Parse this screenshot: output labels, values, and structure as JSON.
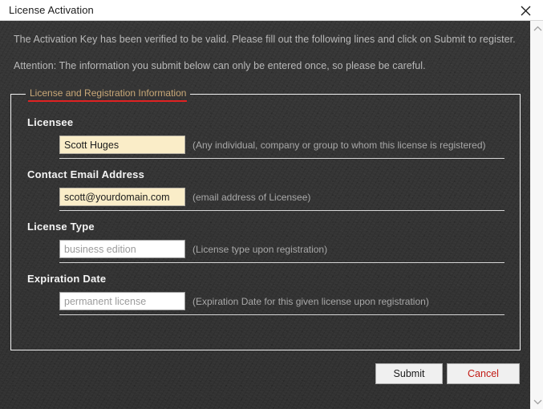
{
  "window": {
    "title": "License Activation",
    "close_icon": "close-icon"
  },
  "intro": {
    "line1": "The Activation Key has been verified to be valid. Please fill out the following lines and click on Submit to register.",
    "line2": "Attention: The information you submit below can only be entered once, so please be careful."
  },
  "fieldset": {
    "legend": "License and Registration Information",
    "fields": [
      {
        "label": "Licensee",
        "value": "Scott Huges",
        "placeholder": "",
        "hint": "(Any individual, company or group to whom this license is registered)",
        "filled": true
      },
      {
        "label": "Contact Email Address",
        "value": "scott@yourdomain.com",
        "placeholder": "",
        "hint": "(email address of Licensee)",
        "filled": true
      },
      {
        "label": "License Type",
        "value": "",
        "placeholder": "business edition",
        "hint": "(License type upon registration)",
        "filled": false
      },
      {
        "label": "Expiration Date",
        "value": "",
        "placeholder": "permanent license",
        "hint": "(Expiration Date for this given license upon registration)",
        "filled": false
      }
    ]
  },
  "buttons": {
    "submit": "Submit",
    "cancel": "Cancel"
  },
  "scrollbar": {
    "up_icon": "chevron-up-icon",
    "down_icon": "chevron-down-icon"
  },
  "colors": {
    "accent_red": "#e02222",
    "cancel_text": "#c21a14",
    "legend_tan": "#c8a878",
    "input_filled_bg": "#faedc8",
    "body_bg": "#343434"
  }
}
